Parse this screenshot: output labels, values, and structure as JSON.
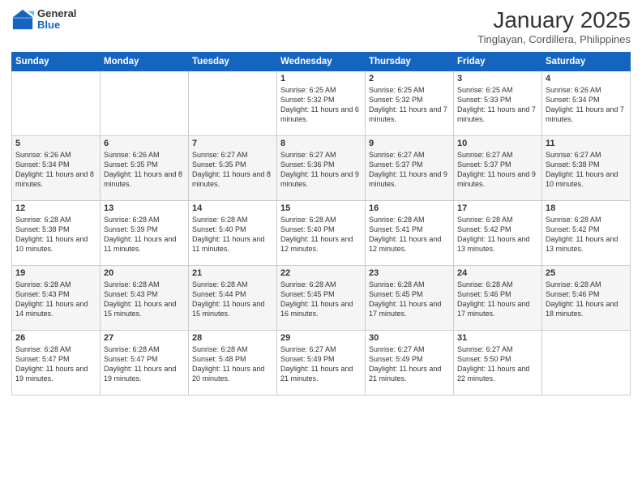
{
  "logo": {
    "general": "General",
    "blue": "Blue"
  },
  "header": {
    "month": "January 2025",
    "location": "Tinglayan, Cordillera, Philippines"
  },
  "days_of_week": [
    "Sunday",
    "Monday",
    "Tuesday",
    "Wednesday",
    "Thursday",
    "Friday",
    "Saturday"
  ],
  "weeks": [
    [
      {
        "day": "",
        "info": ""
      },
      {
        "day": "",
        "info": ""
      },
      {
        "day": "",
        "info": ""
      },
      {
        "day": "1",
        "info": "Sunrise: 6:25 AM\nSunset: 5:32 PM\nDaylight: 11 hours and 6 minutes."
      },
      {
        "day": "2",
        "info": "Sunrise: 6:25 AM\nSunset: 5:32 PM\nDaylight: 11 hours and 7 minutes."
      },
      {
        "day": "3",
        "info": "Sunrise: 6:25 AM\nSunset: 5:33 PM\nDaylight: 11 hours and 7 minutes."
      },
      {
        "day": "4",
        "info": "Sunrise: 6:26 AM\nSunset: 5:34 PM\nDaylight: 11 hours and 7 minutes."
      }
    ],
    [
      {
        "day": "5",
        "info": "Sunrise: 6:26 AM\nSunset: 5:34 PM\nDaylight: 11 hours and 8 minutes."
      },
      {
        "day": "6",
        "info": "Sunrise: 6:26 AM\nSunset: 5:35 PM\nDaylight: 11 hours and 8 minutes."
      },
      {
        "day": "7",
        "info": "Sunrise: 6:27 AM\nSunset: 5:35 PM\nDaylight: 11 hours and 8 minutes."
      },
      {
        "day": "8",
        "info": "Sunrise: 6:27 AM\nSunset: 5:36 PM\nDaylight: 11 hours and 9 minutes."
      },
      {
        "day": "9",
        "info": "Sunrise: 6:27 AM\nSunset: 5:37 PM\nDaylight: 11 hours and 9 minutes."
      },
      {
        "day": "10",
        "info": "Sunrise: 6:27 AM\nSunset: 5:37 PM\nDaylight: 11 hours and 9 minutes."
      },
      {
        "day": "11",
        "info": "Sunrise: 6:27 AM\nSunset: 5:38 PM\nDaylight: 11 hours and 10 minutes."
      }
    ],
    [
      {
        "day": "12",
        "info": "Sunrise: 6:28 AM\nSunset: 5:38 PM\nDaylight: 11 hours and 10 minutes."
      },
      {
        "day": "13",
        "info": "Sunrise: 6:28 AM\nSunset: 5:39 PM\nDaylight: 11 hours and 11 minutes."
      },
      {
        "day": "14",
        "info": "Sunrise: 6:28 AM\nSunset: 5:40 PM\nDaylight: 11 hours and 11 minutes."
      },
      {
        "day": "15",
        "info": "Sunrise: 6:28 AM\nSunset: 5:40 PM\nDaylight: 11 hours and 12 minutes."
      },
      {
        "day": "16",
        "info": "Sunrise: 6:28 AM\nSunset: 5:41 PM\nDaylight: 11 hours and 12 minutes."
      },
      {
        "day": "17",
        "info": "Sunrise: 6:28 AM\nSunset: 5:42 PM\nDaylight: 11 hours and 13 minutes."
      },
      {
        "day": "18",
        "info": "Sunrise: 6:28 AM\nSunset: 5:42 PM\nDaylight: 11 hours and 13 minutes."
      }
    ],
    [
      {
        "day": "19",
        "info": "Sunrise: 6:28 AM\nSunset: 5:43 PM\nDaylight: 11 hours and 14 minutes."
      },
      {
        "day": "20",
        "info": "Sunrise: 6:28 AM\nSunset: 5:43 PM\nDaylight: 11 hours and 15 minutes."
      },
      {
        "day": "21",
        "info": "Sunrise: 6:28 AM\nSunset: 5:44 PM\nDaylight: 11 hours and 15 minutes."
      },
      {
        "day": "22",
        "info": "Sunrise: 6:28 AM\nSunset: 5:45 PM\nDaylight: 11 hours and 16 minutes."
      },
      {
        "day": "23",
        "info": "Sunrise: 6:28 AM\nSunset: 5:45 PM\nDaylight: 11 hours and 17 minutes."
      },
      {
        "day": "24",
        "info": "Sunrise: 6:28 AM\nSunset: 5:46 PM\nDaylight: 11 hours and 17 minutes."
      },
      {
        "day": "25",
        "info": "Sunrise: 6:28 AM\nSunset: 5:46 PM\nDaylight: 11 hours and 18 minutes."
      }
    ],
    [
      {
        "day": "26",
        "info": "Sunrise: 6:28 AM\nSunset: 5:47 PM\nDaylight: 11 hours and 19 minutes."
      },
      {
        "day": "27",
        "info": "Sunrise: 6:28 AM\nSunset: 5:47 PM\nDaylight: 11 hours and 19 minutes."
      },
      {
        "day": "28",
        "info": "Sunrise: 6:28 AM\nSunset: 5:48 PM\nDaylight: 11 hours and 20 minutes."
      },
      {
        "day": "29",
        "info": "Sunrise: 6:27 AM\nSunset: 5:49 PM\nDaylight: 11 hours and 21 minutes."
      },
      {
        "day": "30",
        "info": "Sunrise: 6:27 AM\nSunset: 5:49 PM\nDaylight: 11 hours and 21 minutes."
      },
      {
        "day": "31",
        "info": "Sunrise: 6:27 AM\nSunset: 5:50 PM\nDaylight: 11 hours and 22 minutes."
      },
      {
        "day": "",
        "info": ""
      }
    ]
  ],
  "colors": {
    "header_bg": "#1565c0",
    "header_text": "#ffffff",
    "border": "#cccccc",
    "row_even": "#f5f5f5",
    "row_odd": "#ffffff"
  }
}
